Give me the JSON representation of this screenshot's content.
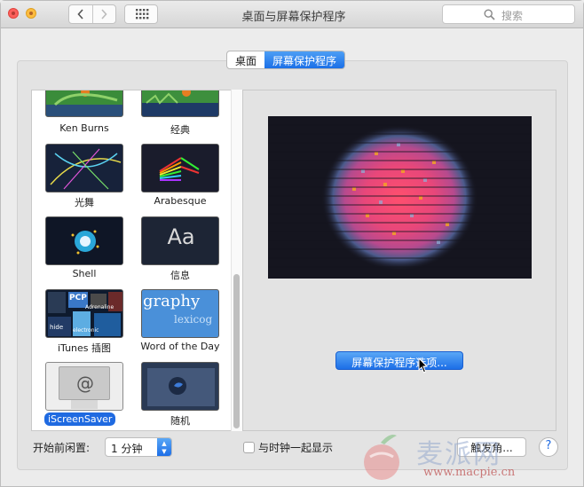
{
  "window": {
    "title": "桌面与屏幕保护程序",
    "search_placeholder": "搜索"
  },
  "tabs": [
    {
      "label": "桌面",
      "active": false
    },
    {
      "label": "屏幕保护程序",
      "active": true
    }
  ],
  "screensavers": [
    {
      "label": "Ken Burns"
    },
    {
      "label": "经典"
    },
    {
      "label": "光舞"
    },
    {
      "label": "Arabesque"
    },
    {
      "label": "Shell"
    },
    {
      "label": "信息",
      "thumb_text": "Aa"
    },
    {
      "label": "iTunes 插图",
      "thumb_text": [
        "PCP",
        "Adrenaline",
        "hide",
        "electronic"
      ]
    },
    {
      "label": "Word of the Day",
      "thumb_text": [
        "graphy",
        "lexicog"
      ]
    },
    {
      "label": "iScreenSaver",
      "selected": true,
      "thumb_text": "@"
    },
    {
      "label": "随机"
    }
  ],
  "preview": {
    "options_button": "屏幕保护程序选项..."
  },
  "bottom": {
    "idle_label": "开始前闲置:",
    "idle_value": "1 分钟",
    "clock_label": "与时钟一起显示",
    "hot_corners": "触发角...",
    "help": "?"
  },
  "watermark": {
    "text": "麦派网",
    "url": "www.macpie.cn"
  },
  "colors": {
    "accent": "#1f6ae1",
    "window_bg": "#ececec",
    "preview_bg": "#15151f"
  }
}
